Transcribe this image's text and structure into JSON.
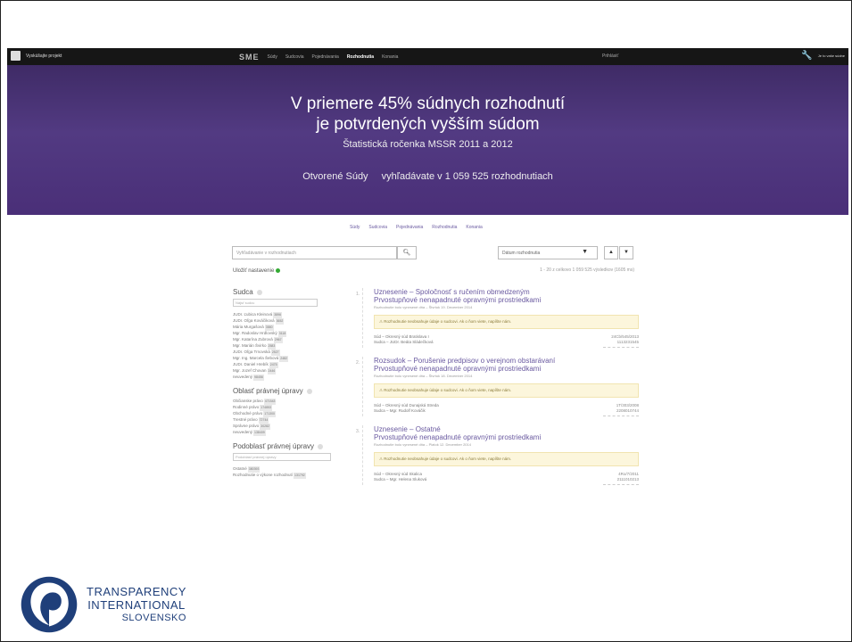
{
  "topbar": {
    "try_label": "Vyskúšajte projekt",
    "logo": "SME",
    "nav": [
      {
        "label": "Súdy",
        "active": false
      },
      {
        "label": "Sudcovia",
        "active": false
      },
      {
        "label": "Pojednávania",
        "active": false
      },
      {
        "label": "Rozhodnutia",
        "active": true
      },
      {
        "label": "Konania",
        "active": false
      }
    ],
    "login": "Prihlásiť",
    "right_text": "Je to vaše súdne"
  },
  "hero": {
    "headline_line1": "V priemere 45% súdnych rozhodnutí",
    "headline_line2": "je potvrdených vyšším súdom",
    "subtitle": "Štatistická ročenka MSSR 2011 a 2012",
    "site_name": "Otvorené Súdy",
    "search_text": "vyhľadávate v 1 059 525 rozhodnutiach"
  },
  "subnav": [
    "Súdy",
    "Sudcovia",
    "Pojednávania",
    "Rozhodnutia",
    "Konania"
  ],
  "search": {
    "placeholder": "Vyhľadávanie v rozhodnutiach",
    "button_icon": "search-icon"
  },
  "sort": {
    "selected": "Dátum rozhodnutia",
    "up_icon": "sort-up-icon",
    "down_icon": "sort-down-icon"
  },
  "alert_link": "Uložiť nastavenie",
  "pager": "1 - 20 z celkovo 1 059 525 výsledkov (1605 ms)",
  "sidebar": {
    "judges": {
      "title": "Sudca",
      "filter_placeholder": "Nájsť sudcu",
      "items": [
        {
          "name": "JUDr. Ľubica Kleinová",
          "count": "3896"
        },
        {
          "name": "JUDr. Oľga Kováčiková",
          "count": "3652"
        },
        {
          "name": "Mária Murgašová",
          "count": "3580"
        },
        {
          "name": "Mgr. Radoslav Hrdlovský",
          "count": "3118"
        },
        {
          "name": "Mgr. Katarína Zubrová",
          "count": "2967"
        },
        {
          "name": "Mgr. Marián Švirko",
          "count": "2583"
        },
        {
          "name": "JUDr. Oľga Trnovská",
          "count": "2527"
        },
        {
          "name": "Mgr. Ing. Marcela Šebová",
          "count": "2482"
        },
        {
          "name": "JUDr. Daniel Hrebík",
          "count": "2475"
        },
        {
          "name": "Mgr. Jozef Chovan",
          "count": "2446"
        },
        {
          "name": "neuvedený",
          "count": "98456"
        }
      ]
    },
    "area": {
      "title": "Oblasť právnej úpravy",
      "items": [
        {
          "name": "Občianske právo",
          "count": "471543"
        },
        {
          "name": "Rodinné právo",
          "count": "174853"
        },
        {
          "name": "Obchodné právo",
          "count": "171300"
        },
        {
          "name": "Trestné právo",
          "count": "72744"
        },
        {
          "name": "Správne právo",
          "count": "30282"
        },
        {
          "name": "neuvedený",
          "count": "138409"
        }
      ]
    },
    "subarea": {
      "title": "Podoblasť právnej úpravy",
      "filter_placeholder": "Podoblasť právnej úpravy",
      "items": [
        {
          "name": "Ostatné",
          "count": "380393"
        },
        {
          "name": "Rozhodnutie o výkone rozhodnutí",
          "count": "131792"
        }
      ]
    }
  },
  "results": [
    {
      "num": "1.",
      "title1": "Uznesenie – Spoločnosť s ručením obmedzeným",
      "title2": "Prvostupňové nenapadnuté opravnými prostriedkami",
      "meta": "Rozhodnutie bolo vynesené dňa – Štvrtok 19. December 2014",
      "warning": "Rozhodnutie neobsahuje údaje o sudcovi. Ak o ňom viete, napíšte nám.",
      "court": "Súd – Okresný súd Bratislava I",
      "judge": "Sudca – JUDr. Beáta Sládečková",
      "ref1": "24Cb/545/2013",
      "ref2": "1113231545"
    },
    {
      "num": "2.",
      "title1": "Rozsudok – Porušenie predpisov o verejnom obstarávaní",
      "title2": "Prvostupňové nenapadnuté opravnými prostriedkami",
      "meta": "Rozhodnutie bolo vynesené dňa – Štvrtok 18. December 2014",
      "warning": "Rozhodnutie neobsahuje údaje o sudcovi. Ak o ňom viete, napíšte nám.",
      "court": "Súd – Okresný súd Dunajská Streda",
      "judge": "Sudca – Mgr. Rudolf Kováčik",
      "ref1": "1T/303/2008",
      "ref2": "2208010744"
    },
    {
      "num": "3.",
      "title1": "Uznesenie – Ostatné",
      "title2": "Prvostupňové nenapadnuté opravnými prostriedkami",
      "meta": "Rozhodnutie bolo vynesené dňa – Piatok 12. December 2014",
      "warning": "Rozhodnutie neobsahuje údaje o sudcovi. Ak o ňom viete, napíšte nám.",
      "court": "Súd – Okresný súd Skalica",
      "judge": "Sudca – Mgr. Helena Sluková",
      "ref1": "4Ro/7/2011",
      "ref2": "2111010213"
    }
  ],
  "logo": {
    "line1": "TRANSPARENCY",
    "line2": "INTERNATIONAL",
    "line3": "SLOVENSKO"
  },
  "colors": {
    "hero": "#4a3278",
    "accent": "#6a5aa0",
    "warning_bg": "#fcf6dc",
    "logo_blue": "#1f3f7a"
  }
}
